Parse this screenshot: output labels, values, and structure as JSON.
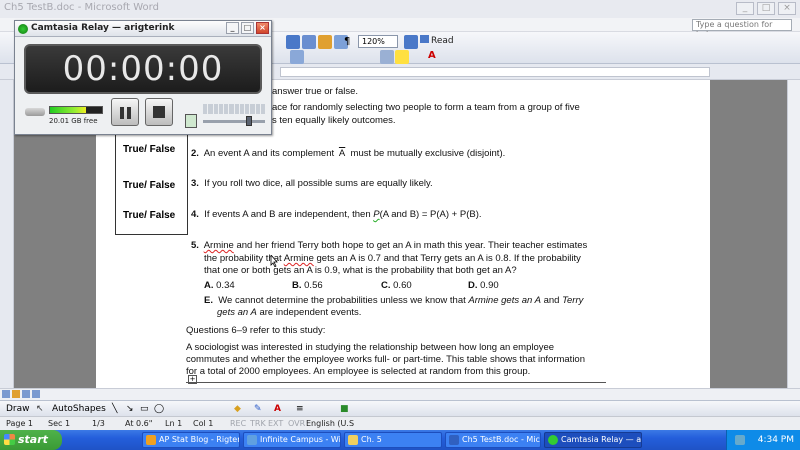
{
  "word": {
    "title": "Ch5 TestB.doc - Microsoft Word",
    "help_placeholder": "Type a question for help",
    "zoom": "120%",
    "read_label": "Read"
  },
  "camtasia": {
    "title": "Camtasia Relay — arigterink",
    "timer": "00:00:00",
    "disk_free": "20.01 GB free",
    "input_level": 0.7,
    "volume_level": 0.7
  },
  "document": {
    "intro_frag": "answer true or false.",
    "q1_frag_line1": "ace for randomly selecting two people to form a team from a group of five",
    "q1_frag_line2": "s ten equally likely outcomes.",
    "tf_label": "True/ False",
    "q2": {
      "num": "2.",
      "text_a": "An event A and its complement",
      "text_sym": "A",
      "text_b": "must be mutually exclusive (disjoint)."
    },
    "q3": {
      "num": "3.",
      "text": "If you roll two dice, all possible sums are equally likely."
    },
    "q4": {
      "num": "4.",
      "text_a": "If events A and B are independent, then",
      "text_p": "P",
      "text_b": "(A and B) = P(A) + P(B)."
    },
    "q5": {
      "num": "5.",
      "name": "Armine",
      "line1": "and her friend Terry both hope to get an A in math this year. Their teacher estimates",
      "line2a": "the probability that",
      "line2b": "gets an A is 0.7 and that Terry gets an A is 0.8. If the probability",
      "line3": "that one or both gets an A is 0.9, what is the probability that both get an A?",
      "choices": [
        {
          "letter": "A.",
          "value": "0.34"
        },
        {
          "letter": "B.",
          "value": "0.56"
        },
        {
          "letter": "C.",
          "value": "0.60"
        },
        {
          "letter": "D.",
          "value": "0.90"
        }
      ],
      "choice_e_letter": "E.",
      "choice_e_line1a": "We cannot determine the probabilities unless we know that",
      "choice_e_line1b": "Armine gets an A",
      "choice_e_line1c": "and",
      "choice_e_line1d": "Terry",
      "choice_e_line2a": "gets an A",
      "choice_e_line2b": "are independent events."
    },
    "study_intro": "Questions 6–9 refer to this study:",
    "study_line1": "A sociologist was interested in studying the relationship between how long an employee",
    "study_line2": "commutes and whether the employee works full- or part-time. This table shows that information",
    "study_line3": "for a total of 2000 employees. An employee is selected at random from this group."
  },
  "drawbar": {
    "draw_label": "Draw",
    "autoshapes_label": "AutoShapes"
  },
  "status": {
    "page": "Page 1",
    "sec": "Sec 1",
    "pages": "1/3",
    "at": "At 0.6\"",
    "ln": "Ln 1",
    "col": "Col 1",
    "rec": "REC",
    "trk": "TRK",
    "ext": "EXT",
    "ovr": "OVR",
    "lang": "English (U.S"
  },
  "taskbar": {
    "start_label": "start",
    "tasks": [
      "AP Stat Blog - Rigteri...",
      "Infinite Campus - Win...",
      "Ch. 5",
      "Ch5 TestB.doc - Micr...",
      "Camtasia Relay — ari..."
    ],
    "clock": "4:34 PM"
  }
}
